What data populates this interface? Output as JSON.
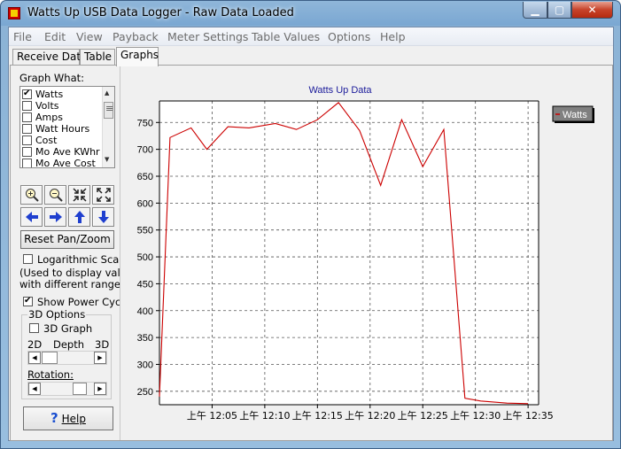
{
  "window": {
    "title": "Watts Up USB Data Logger - Raw Data Loaded",
    "min": "▁",
    "max": "▢",
    "close": "✕"
  },
  "menu": [
    "File",
    "Edit",
    "View",
    "Payback",
    "Meter Settings",
    "Table Values",
    "Options",
    "Help"
  ],
  "tabs": [
    "Receive Data",
    "Table",
    "Graphs"
  ],
  "panel": {
    "graph_what_label": "Graph What:",
    "graph_what_items": [
      {
        "label": "Watts",
        "checked": true
      },
      {
        "label": "Volts",
        "checked": false
      },
      {
        "label": "Amps",
        "checked": false
      },
      {
        "label": "Watt Hours",
        "checked": false
      },
      {
        "label": "Cost",
        "checked": false
      },
      {
        "label": "Mo Ave KWhr",
        "checked": false
      },
      {
        "label": "Mo Ave Cost",
        "checked": false
      }
    ],
    "reset_label": "Reset Pan/Zoom",
    "log_scales_label": "Logarithmic Scales",
    "log_scales_note1": "(Used to display values",
    "log_scales_note2": "with different ranges.)",
    "show_power_label": "Show Power Cyc.",
    "options_group_label": "3D Options",
    "graph3d_label": "3D Graph",
    "depth_2d": "2D",
    "depth_label": "Depth",
    "depth_3d": "3D",
    "rotation_label": "Rotation:",
    "help_label": "Help"
  },
  "chart_data": {
    "type": "line",
    "title": "Watts Up Data",
    "legend": [
      "Watts"
    ],
    "legend_placement": "top-right",
    "grid": true,
    "x_time_prefix": "上午",
    "x_ticks": [
      "12:05",
      "12:10",
      "12:15",
      "12:20",
      "12:25",
      "12:30",
      "12:35"
    ],
    "y_ticks": [
      250,
      300,
      350,
      400,
      450,
      500,
      550,
      600,
      650,
      700,
      750
    ],
    "ylim": [
      225,
      790
    ],
    "series": [
      {
        "name": "Watts",
        "color": "#cc0000",
        "x": [
          "12:00",
          "12:01",
          "12:03",
          "12:04.5",
          "12:06.5",
          "12:08.5",
          "12:11",
          "12:13",
          "12:15",
          "12:17",
          "12:19",
          "12:21",
          "12:23",
          "12:25",
          "12:27",
          "12:29",
          "12:30.5",
          "12:33",
          "12:35"
        ],
        "y": [
          240,
          722,
          740,
          700,
          742,
          740,
          748,
          737,
          755,
          787,
          735,
          633,
          755,
          668,
          737,
          237,
          232,
          228,
          227
        ]
      }
    ]
  }
}
